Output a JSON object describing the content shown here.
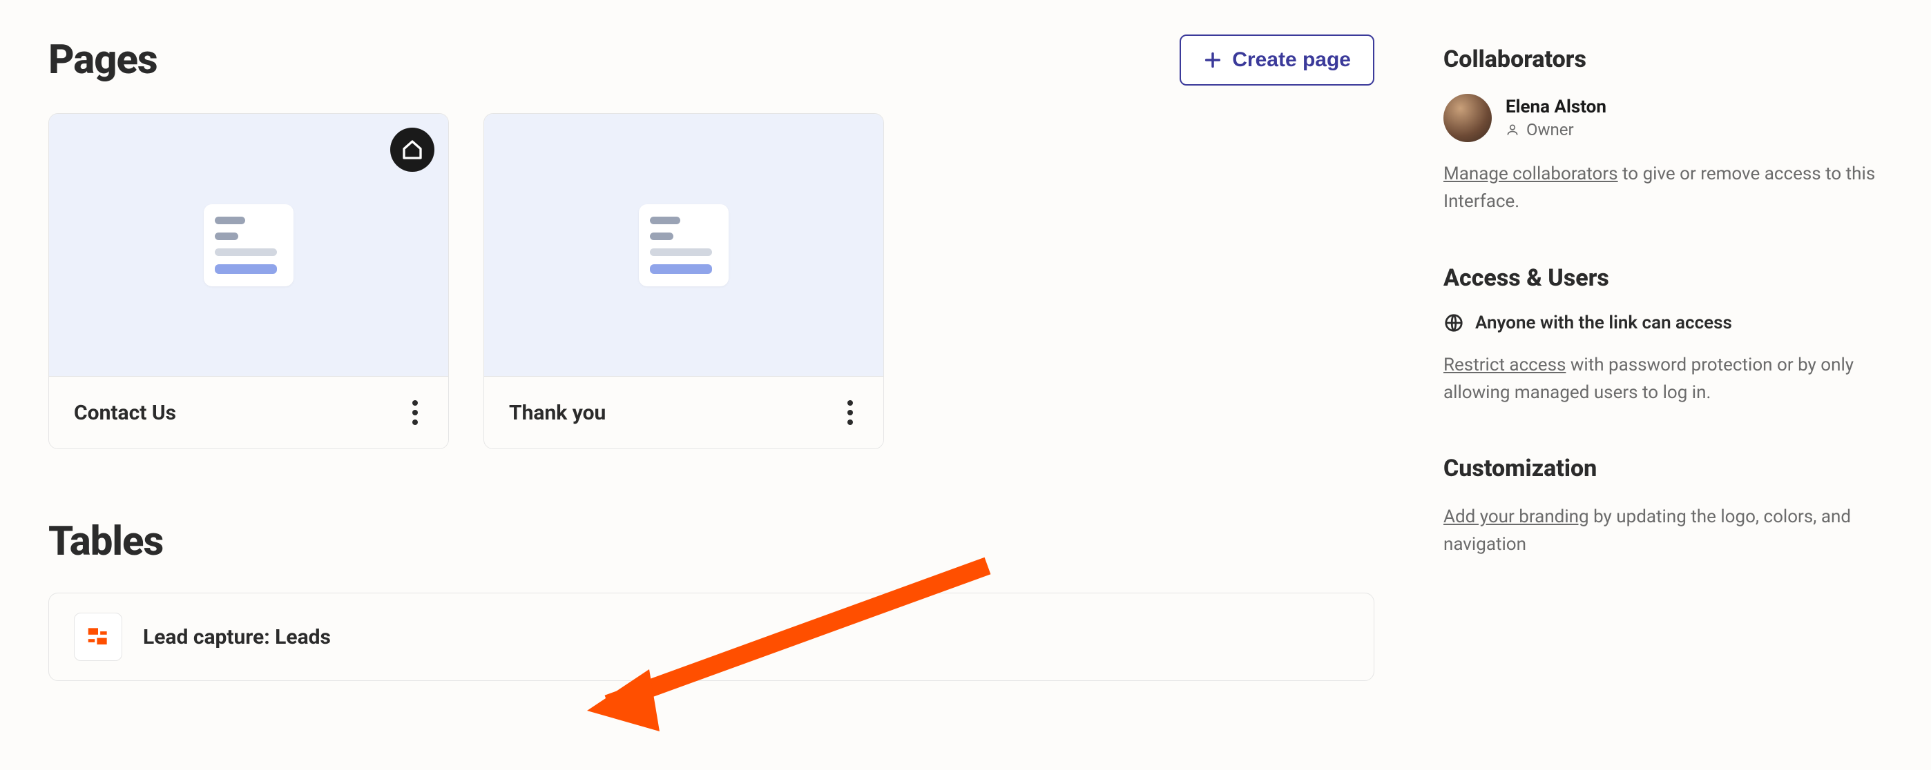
{
  "sections": {
    "pages_title": "Pages",
    "tables_title": "Tables"
  },
  "create_page_label": "Create page",
  "pages": [
    {
      "title": "Contact Us",
      "is_home": true
    },
    {
      "title": "Thank you",
      "is_home": false
    }
  ],
  "tables": [
    {
      "name": "Lead capture: Leads"
    }
  ],
  "sidebar": {
    "collaborators": {
      "title": "Collaborators",
      "user_name": "Elena Alston",
      "user_role": "Owner",
      "manage_link": "Manage collaborators",
      "manage_suffix": " to give or remove access to this Interface."
    },
    "access": {
      "title": "Access & Users",
      "status": "Anyone with the link can access",
      "restrict_link": "Restrict access",
      "restrict_suffix": " with password protection or by only allowing managed users to log in."
    },
    "customization": {
      "title": "Customization",
      "branding_link": "Add your branding",
      "branding_suffix": " by updating the logo, colors, and navigation"
    }
  }
}
